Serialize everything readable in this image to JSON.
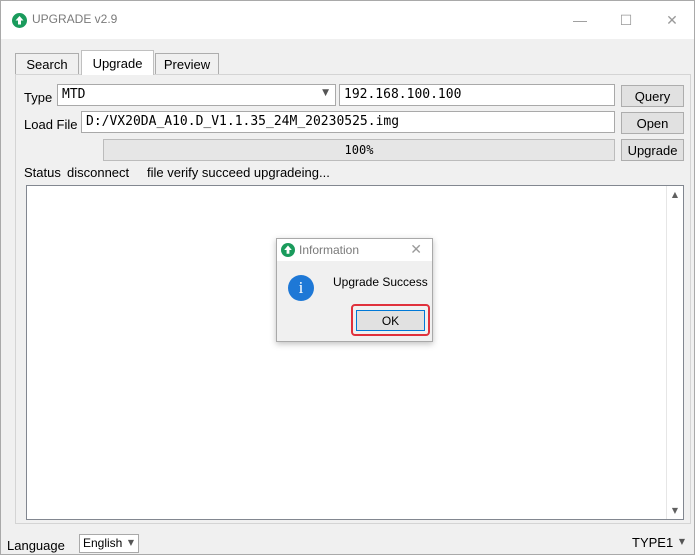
{
  "window": {
    "title": "UPGRADE v2.9",
    "minimize_glyph": "—",
    "maximize_glyph": "☐",
    "close_glyph": "✕",
    "accent_color": "#1a9b5c"
  },
  "tabs": [
    {
      "label": "Search",
      "active": false
    },
    {
      "label": "Upgrade",
      "active": true
    },
    {
      "label": "Preview",
      "active": false
    }
  ],
  "upgrade": {
    "type_label": "Type",
    "type_value": "MTD",
    "ip_value": "192.168.100.100",
    "query_button": "Query",
    "load_file_label": "Load File",
    "file_path": "D:/VX20DA_A10.D_V1.1.35_24M_20230525.img",
    "open_button": "Open",
    "progress_text": "100%",
    "progress_value": 1.0,
    "upgrade_button": "Upgrade",
    "status_label": "Status",
    "status_connection": "disconnect",
    "status_message": "file verify succeed upgradeing..."
  },
  "dialog": {
    "title": "Information",
    "close_glyph": "✕",
    "message": "Upgrade Success",
    "ok_button": "OK",
    "info_glyph": "i",
    "highlight_color": "#e0313c"
  },
  "footer": {
    "language_label": "Language",
    "language_value": "English",
    "type_select_value": "TYPE1"
  }
}
